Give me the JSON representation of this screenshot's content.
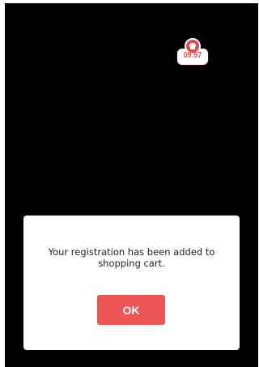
{
  "timer": {
    "value": "09:57",
    "icon": "alarm-clock-icon",
    "color": "#e64848"
  },
  "dialog": {
    "message": "Your registration has been added to shopping cart.",
    "ok_label": "OK",
    "button_color": "#ec5656"
  }
}
